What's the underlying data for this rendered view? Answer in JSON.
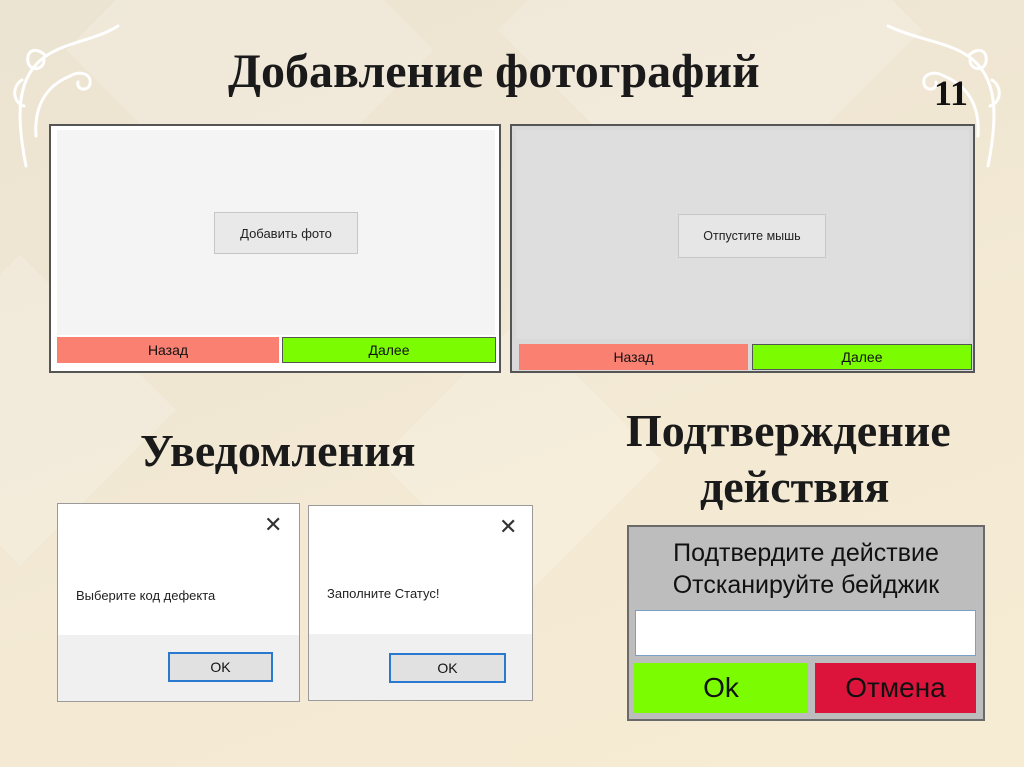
{
  "slide": {
    "title": "Добавление фотографий",
    "number": "11",
    "section_notifications": "Уведомления",
    "section_confirm_line1": "Подтверждение",
    "section_confirm_line2": "действия"
  },
  "photo_window_1": {
    "center_button": "Добавить фото",
    "back_label": "Назад",
    "next_label": "Далее"
  },
  "photo_window_2": {
    "center_button": "Отпустите мышь",
    "back_label": "Назад",
    "next_label": "Далее"
  },
  "dialog_1": {
    "message": "Выберите код дефекта",
    "ok_label": "OK"
  },
  "dialog_2": {
    "message": "Заполните Статус!",
    "ok_label": "OK"
  },
  "confirm_panel": {
    "line1": "Подтвердите действие",
    "line2": "Отсканируйте бейджик",
    "badge_value": "",
    "ok_label": "Ok",
    "cancel_label": "Отмена"
  },
  "colors": {
    "back": "#fa8072",
    "next": "#7cfc00",
    "cancel": "#dc143c",
    "dialog_focus": "#2b78d0"
  },
  "icons": [
    "close-icon",
    "corner-ornament-left",
    "corner-ornament-right"
  ]
}
